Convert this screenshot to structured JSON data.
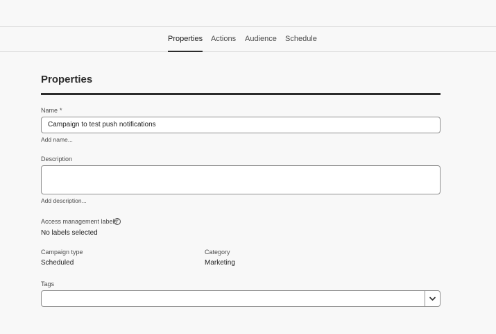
{
  "tabs": [
    {
      "label": "Properties",
      "active": true
    },
    {
      "label": "Actions",
      "active": false
    },
    {
      "label": "Audience",
      "active": false
    },
    {
      "label": "Schedule",
      "active": false
    }
  ],
  "properties": {
    "title": "Properties",
    "name": {
      "label": "Name",
      "required_mark": "*",
      "value": "Campaign to test push notifications",
      "helper": "Add name..."
    },
    "description": {
      "label": "Description",
      "value": "",
      "helper": "Add description..."
    },
    "access_labels": {
      "label": "Access management labels",
      "value": "No labels selected"
    },
    "campaign_type": {
      "label": "Campaign type",
      "value": "Scheduled"
    },
    "category": {
      "label": "Category",
      "value": "Marketing"
    },
    "tags": {
      "label": "Tags",
      "value": ""
    }
  },
  "icons": {
    "help": "help-circle-icon",
    "dropdown": "chevron-down-icon"
  }
}
